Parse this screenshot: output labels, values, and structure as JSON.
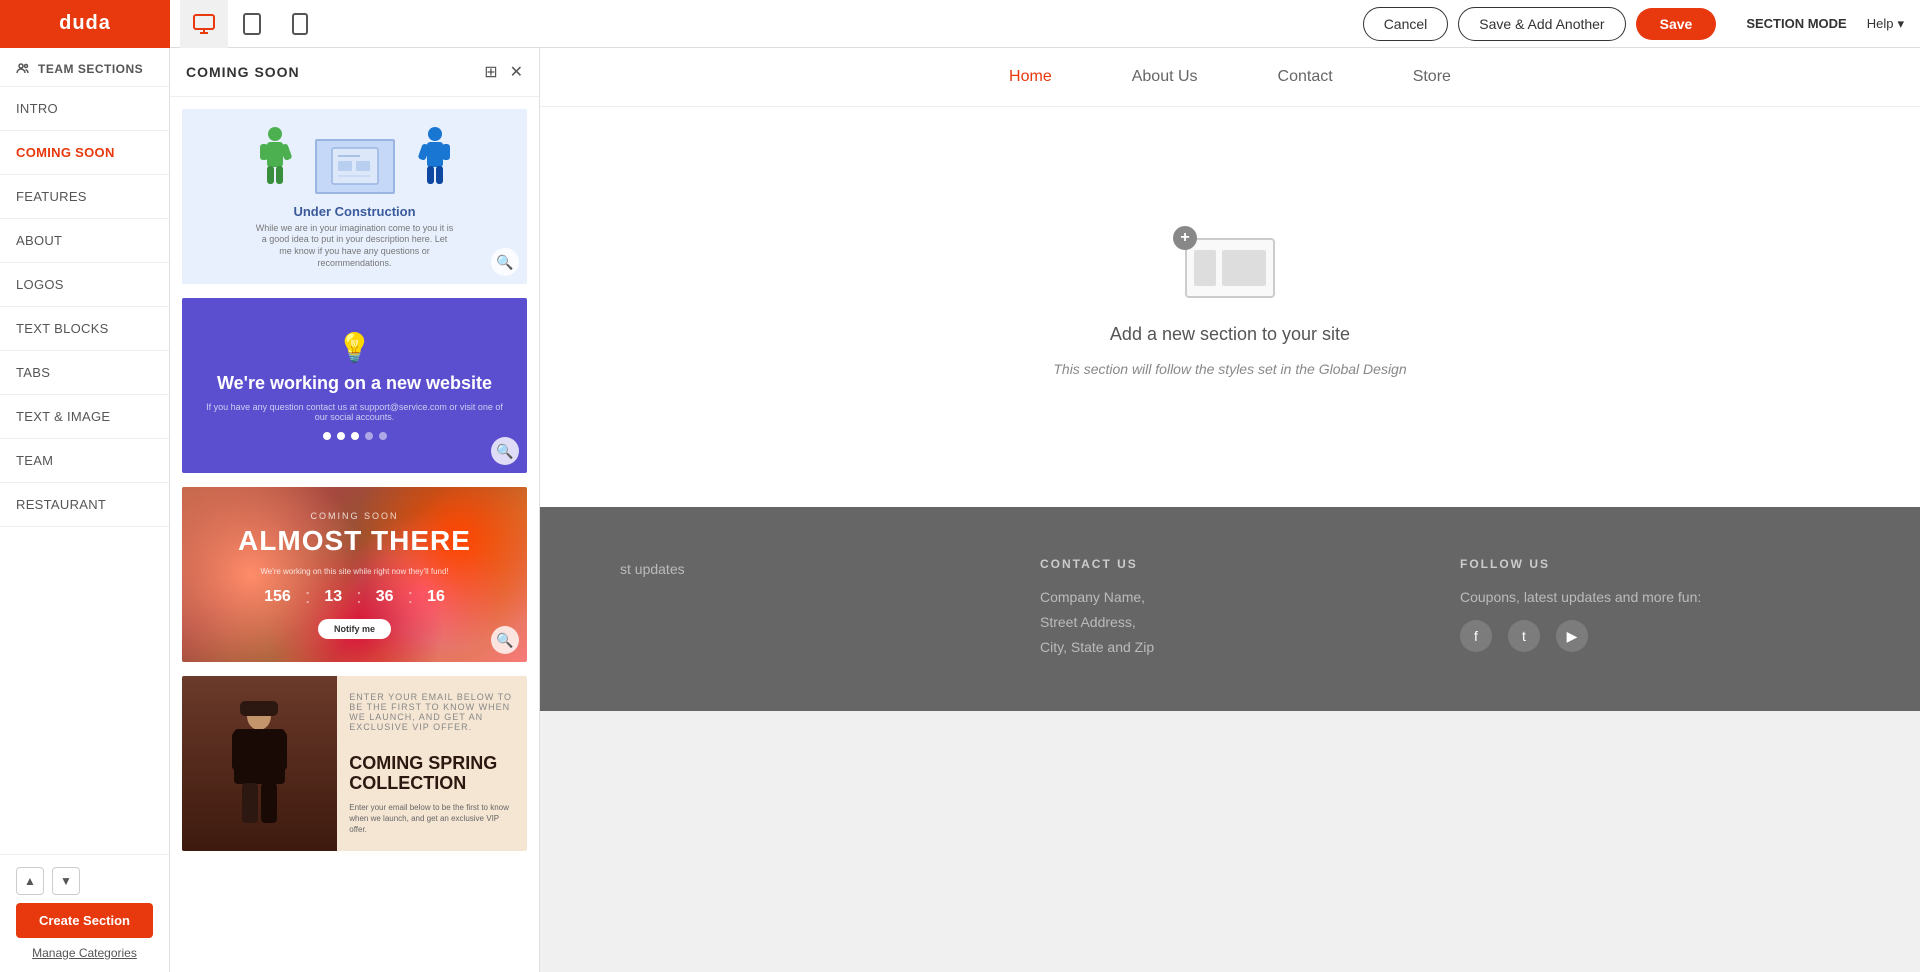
{
  "topbar": {
    "logo": "duda",
    "cancel_label": "Cancel",
    "save_add_label": "Save & Add Another",
    "save_label": "Save",
    "section_mode_label": "SECTION MODE",
    "help_label": "Help"
  },
  "devices": [
    {
      "id": "desktop",
      "active": true
    },
    {
      "id": "tablet",
      "active": false
    },
    {
      "id": "mobile",
      "active": false
    }
  ],
  "sidebar": {
    "header": "TEAM SECTIONS",
    "items": [
      {
        "id": "intro",
        "label": "INTRO",
        "active": false
      },
      {
        "id": "coming-soon",
        "label": "COMING SOON",
        "active": true
      },
      {
        "id": "features",
        "label": "FEATURES",
        "active": false
      },
      {
        "id": "about",
        "label": "ABOUT",
        "active": false
      },
      {
        "id": "logos",
        "label": "LOGOS",
        "active": false
      },
      {
        "id": "text-blocks",
        "label": "TEXT BLOCKS",
        "active": false
      },
      {
        "id": "tabs",
        "label": "TABS",
        "active": false
      },
      {
        "id": "text-image",
        "label": "TEXT & IMAGE",
        "active": false
      },
      {
        "id": "team",
        "label": "TEAM",
        "active": false
      },
      {
        "id": "restaurant",
        "label": "RESTAURANT",
        "active": false
      }
    ],
    "create_section_label": "Create Section",
    "manage_categories_label": "Manage Categories"
  },
  "panel": {
    "title": "COMING SOON",
    "cards": [
      {
        "id": "under-construction",
        "title": "Under Construction",
        "subtitle": "While we are in your imagination come to you it is a good idea to put in your description here. Let me know if you have any questions or recommendations."
      },
      {
        "id": "working",
        "emoji": "💡",
        "title": "We're working on a new website",
        "subtitle": "If you have any question contact us at support@service.com or visit one of our social accounts.",
        "dots": [
          true,
          true,
          true,
          false,
          false
        ]
      },
      {
        "id": "almost-there",
        "top_label": "COMING SOON",
        "title": "ALMOST THERE",
        "subtitle": "We're working on this site while right now they'll fund!",
        "numbers": [
          {
            "value": "156",
            "label": ""
          },
          {
            "value": "13",
            "label": ""
          },
          {
            "value": "36",
            "label": ""
          },
          {
            "value": "16",
            "label": ""
          }
        ],
        "button_label": "Notify me"
      },
      {
        "id": "coming-spring",
        "sup_label": "Enter your email below to be the first to know when we launch, and get an exclusive VIP offer.",
        "title": "COMING SPRING COLLECTION"
      }
    ]
  },
  "site": {
    "nav_links": [
      {
        "id": "home",
        "label": "Home",
        "active": true
      },
      {
        "id": "about",
        "label": "About Us",
        "active": false
      },
      {
        "id": "contact",
        "label": "Contact",
        "active": false
      },
      {
        "id": "store",
        "label": "Store",
        "active": false
      }
    ],
    "add_section": {
      "plus": "+",
      "title": "Add a new section to your site",
      "subtitle": "This section will follow the styles set in the Global Design"
    },
    "footer": {
      "col1_title": "",
      "col1_items": [
        "st updates"
      ],
      "col2_title": "CONTACT US",
      "col2_items": [
        "Company Name,",
        "Street Address,",
        "City, State and Zip"
      ],
      "col3_title": "FOLLOW US",
      "col3_text": "Coupons, latest updates and more fun:",
      "social_icons": [
        "f",
        "t",
        "▶"
      ]
    }
  }
}
